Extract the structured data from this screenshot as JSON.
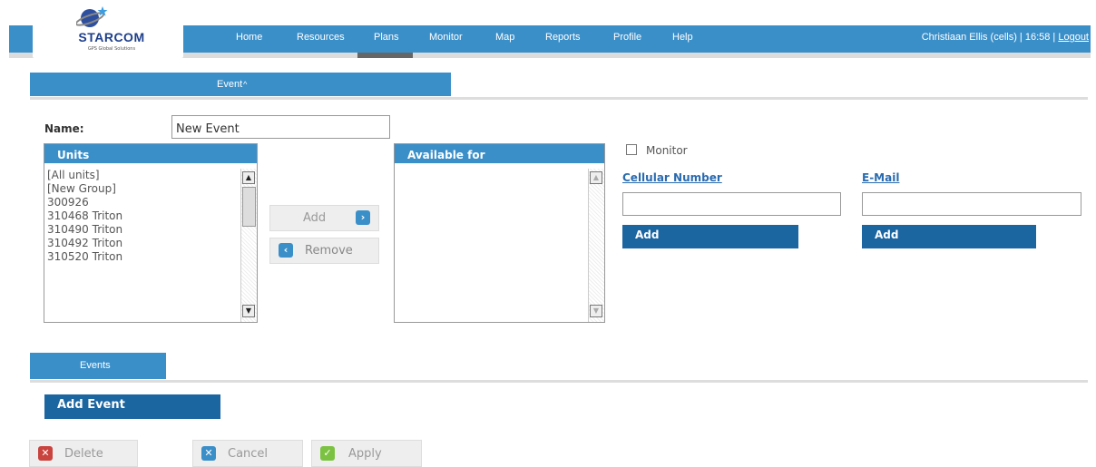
{
  "logo": {
    "name": "STARCOM",
    "tagline": "GPS Global Solutions"
  },
  "nav": [
    "Home",
    "Resources",
    "Plans",
    "Monitor",
    "Map",
    "Reports",
    "Profile",
    "Help"
  ],
  "user": {
    "info": "Christiaan Ellis (cells) | 16:58 |",
    "logout": "Logout"
  },
  "event_section": {
    "title": "Event",
    "chevron": "^"
  },
  "name_field": {
    "label": "Name:",
    "value": "New Event"
  },
  "units": {
    "header": "Units",
    "items": [
      "[All units]",
      "[New Group]",
      "300926",
      "310468 Triton",
      "310490 Triton",
      "310492 Triton",
      "310520 Triton"
    ]
  },
  "add_button": "Add",
  "remove_button": "Remove",
  "available": {
    "header": "Available for"
  },
  "monitor": {
    "label": "Monitor",
    "checked": false
  },
  "cellular": {
    "label": "Cellular Number",
    "value": "",
    "add": "Add"
  },
  "email": {
    "label": "E-Mail",
    "value": "",
    "add": "Add"
  },
  "events_section": {
    "title": "Events"
  },
  "add_event": "Add Event",
  "actions": {
    "delete": "Delete",
    "cancel": "Cancel",
    "apply": "Apply"
  },
  "colors": {
    "header_blue": "#3b8fc9",
    "dark_blue": "#1b65a1",
    "red": "#c9443f",
    "green": "#7cc242"
  }
}
